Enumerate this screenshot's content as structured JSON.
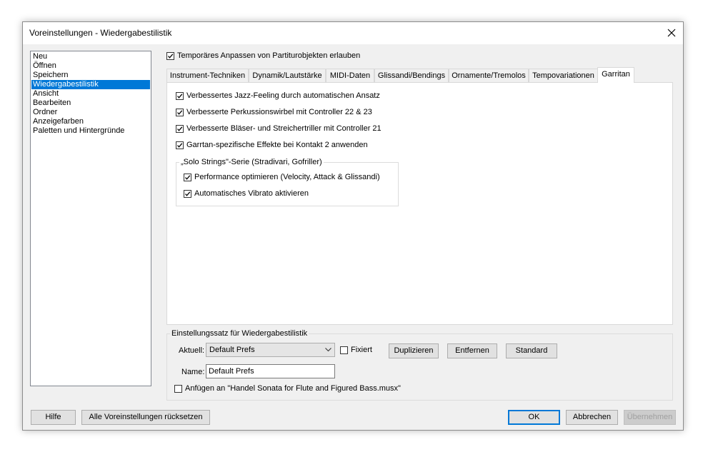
{
  "window": {
    "title": "Voreinstellungen - Wiedergabestilistik"
  },
  "sidebar": {
    "items": [
      {
        "label": "Neu",
        "selected": false
      },
      {
        "label": "Öffnen",
        "selected": false
      },
      {
        "label": "Speichern",
        "selected": false
      },
      {
        "label": "Wiedergabestilistik",
        "selected": true
      },
      {
        "label": "Ansicht",
        "selected": false
      },
      {
        "label": "Bearbeiten",
        "selected": false
      },
      {
        "label": "Ordner",
        "selected": false
      },
      {
        "label": "Anzeigefarben",
        "selected": false
      },
      {
        "label": "Paletten und Hintergründe",
        "selected": false
      }
    ]
  },
  "top_option": {
    "label": "Temporäres Anpassen von Partiturobjekten erlauben",
    "checked": true
  },
  "tabs": [
    {
      "label": "Instrument-Techniken",
      "active": false
    },
    {
      "label": "Dynamik/Lautstärke",
      "active": false
    },
    {
      "label": "MIDI-Daten",
      "active": false
    },
    {
      "label": "Glissandi/Bendings",
      "active": false
    },
    {
      "label": "Ornamente/Tremolos",
      "active": false
    },
    {
      "label": "Tempovariationen",
      "active": false
    },
    {
      "label": "Garritan",
      "active": true
    }
  ],
  "garritan": {
    "options": [
      {
        "label": "Verbessertes Jazz-Feeling durch automatischen Ansatz",
        "checked": true
      },
      {
        "label": "Verbesserte Perkussionswirbel mit Controller 22 & 23",
        "checked": true
      },
      {
        "label": "Verbesserte Bläser- und Streichertriller mit Controller 21",
        "checked": true
      },
      {
        "label": "Garrtan-spezifische Effekte bei Kontakt 2 anwenden",
        "checked": true
      }
    ],
    "solo_group": {
      "title": "„Solo Strings\"-Serie (Stradivari, Gofriller)",
      "options": [
        {
          "label": "Performance optimieren (Velocity, Attack & Glissandi)",
          "checked": true
        },
        {
          "label": "Automatisches Vibrato aktivieren",
          "checked": true
        }
      ]
    }
  },
  "settings_set": {
    "title": "Einstellungssatz für Wiedergabestilistik",
    "current_label": "Aktuell:",
    "current_value": "Default Prefs",
    "fixed_label": "Fixiert",
    "fixed_checked": false,
    "duplicate_label": "Duplizieren",
    "remove_label": "Entfernen",
    "standard_label": "Standard",
    "name_label": "Name:",
    "name_value": "Default Prefs",
    "append_label": "Anfügen an \"Handel Sonata for Flute and Figured Bass.musx\"",
    "append_checked": false
  },
  "footer": {
    "help_label": "Hilfe",
    "reset_label": "Alle Voreinstellungen rücksetzen",
    "ok_label": "OK",
    "cancel_label": "Abbrechen",
    "apply_label": "Übernehmen"
  },
  "colors": {
    "selection": "#0078d7",
    "dialog_bg": "#f0f0f0",
    "default_button_border": "#0078d7"
  }
}
